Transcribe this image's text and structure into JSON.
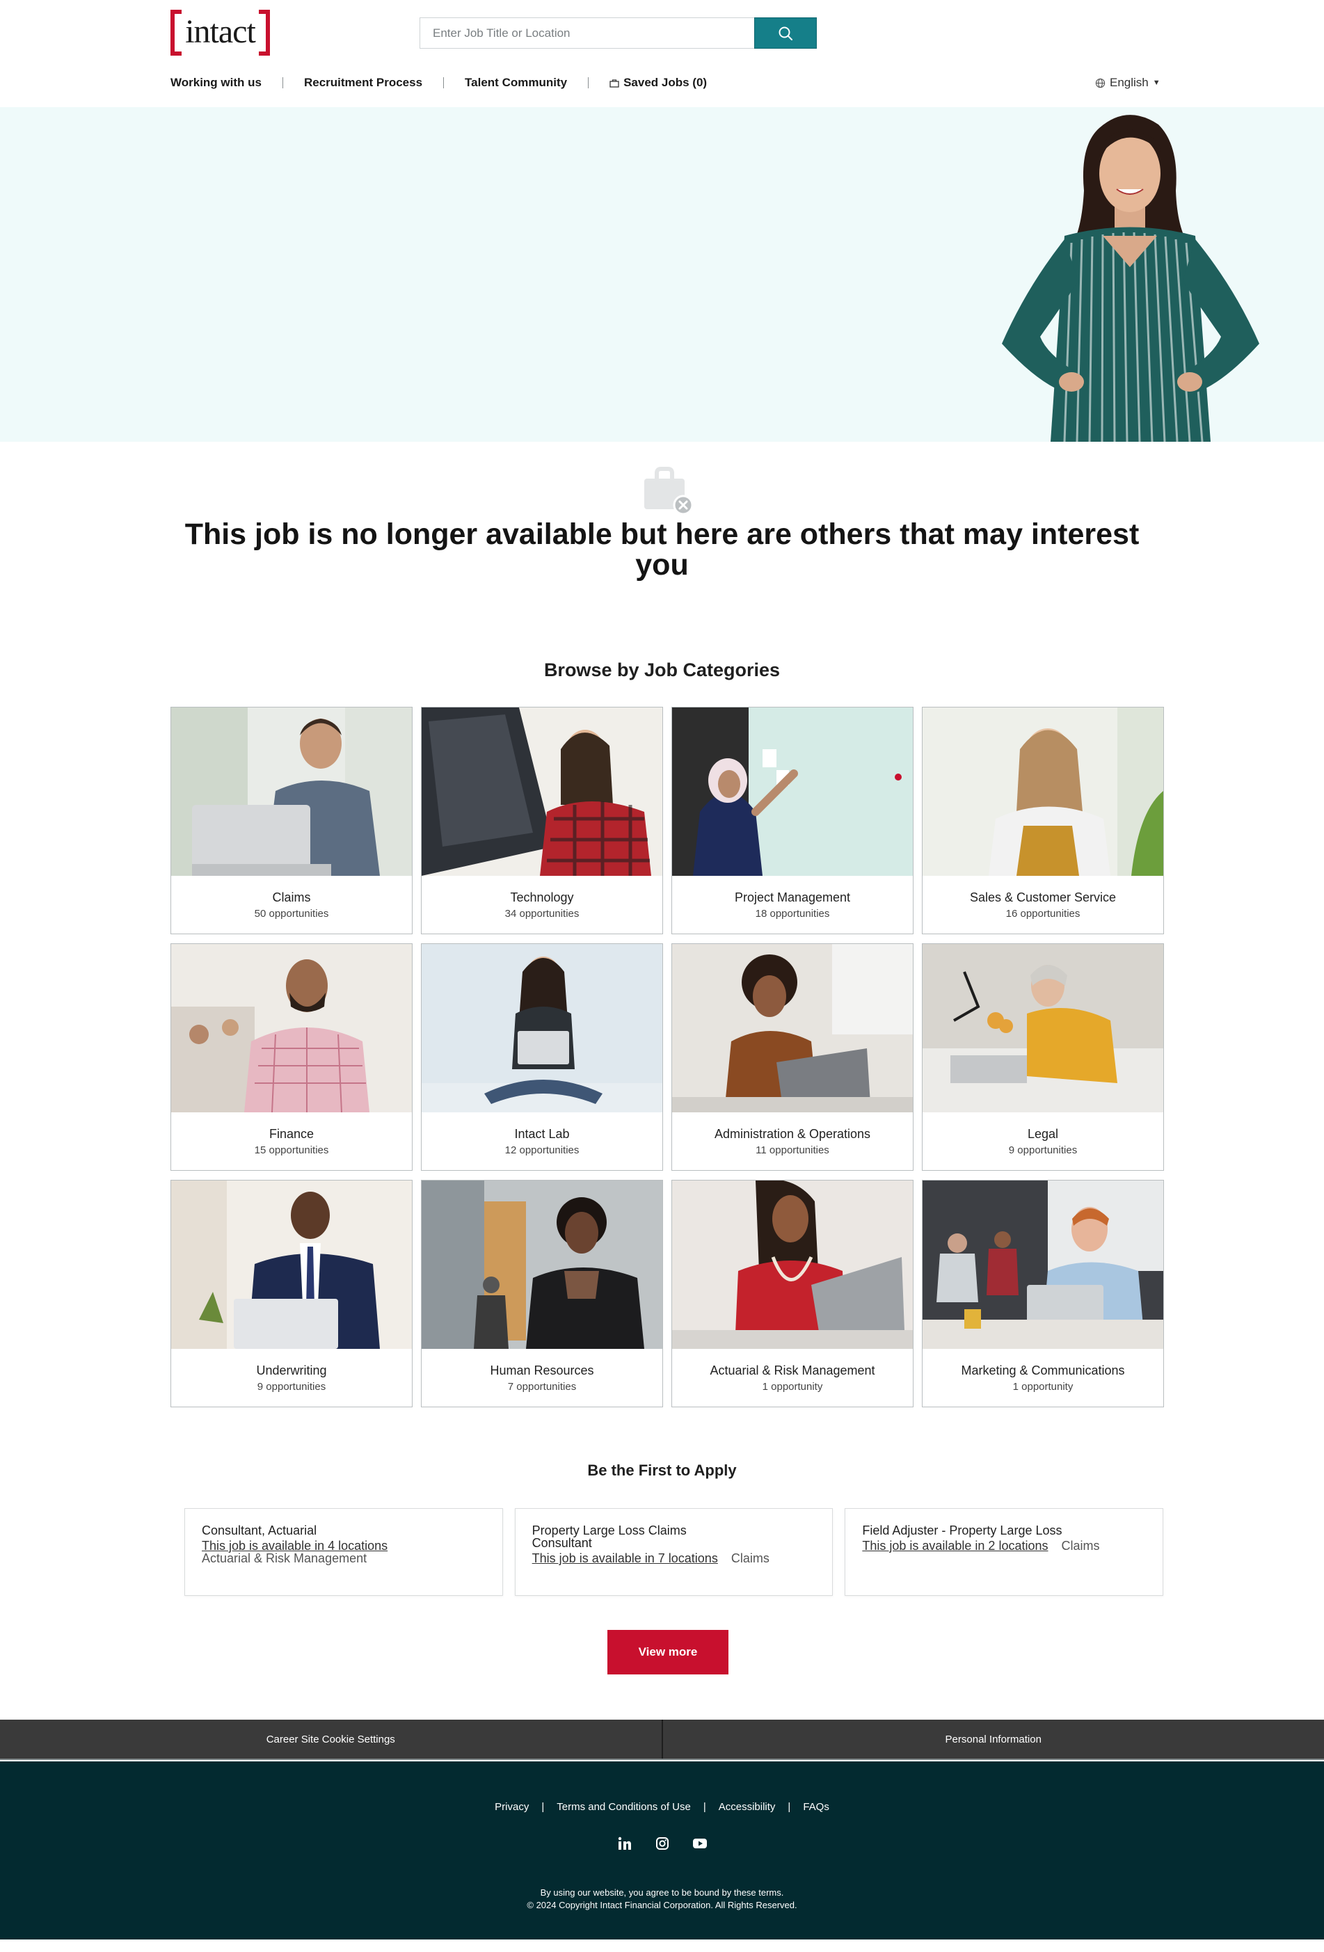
{
  "header": {
    "logo_text": "intact",
    "search": {
      "placeholder": "Enter Job Title or Location"
    },
    "nav": [
      {
        "label": "Working with us"
      },
      {
        "label": "Recruitment Process"
      },
      {
        "label": "Talent Community"
      },
      {
        "label": "Saved Jobs (0)"
      }
    ],
    "language": "English"
  },
  "notice": {
    "title": "This job is no longer available but here are others that may interest you"
  },
  "categories": {
    "title": "Browse by Job Categories",
    "items": [
      {
        "name": "Claims",
        "count": "50 opportunities"
      },
      {
        "name": "Technology",
        "count": "34 opportunities"
      },
      {
        "name": "Project Management",
        "count": "18 opportunities"
      },
      {
        "name": "Sales & Customer Service",
        "count": "16 opportunities"
      },
      {
        "name": "Finance",
        "count": "15 opportunities"
      },
      {
        "name": "Intact Lab",
        "count": "12 opportunities"
      },
      {
        "name": "Administration & Operations",
        "count": "11 opportunities"
      },
      {
        "name": "Legal",
        "count": "9 opportunities"
      },
      {
        "name": "Underwriting",
        "count": "9 opportunities"
      },
      {
        "name": "Human Resources",
        "count": "7 opportunities"
      },
      {
        "name": "Actuarial & Risk Management",
        "count": "1 opportunity"
      },
      {
        "name": "Marketing & Communications",
        "count": "1 opportunity"
      }
    ]
  },
  "jobs": {
    "title": "Be the First to Apply",
    "items": [
      {
        "title": "Consultant, Actuarial",
        "locations": "This job is available in 4 locations",
        "category": "Actuarial & Risk Management"
      },
      {
        "title": "Property Large Loss Claims Consultant",
        "locations": "This job is available in 7 locations",
        "category": "Claims"
      },
      {
        "title": "Field Adjuster - Property Large Loss",
        "locations": "This job is available in 2 locations",
        "category": "Claims"
      }
    ],
    "view_more": "View more"
  },
  "footer": {
    "cookie_settings": "Career Site Cookie Settings",
    "personal_information": "Personal Information",
    "links": [
      {
        "label": "Privacy"
      },
      {
        "label": "Terms and Conditions of Use"
      },
      {
        "label": "Accessibility"
      },
      {
        "label": "FAQs"
      }
    ],
    "social": [
      "linkedin-icon",
      "instagram-icon",
      "youtube-icon"
    ],
    "terms_line": "By using our website, you agree to be bound by these terms.",
    "copyright": "© 2024 Copyright Intact Financial Corporation. All Rights Reserved."
  },
  "colors": {
    "brand_red": "#c8102e",
    "teal": "#157f89",
    "hero_bg": "#effafa",
    "footer_bg": "#032a30",
    "cookie_bar_bg": "#3a3a3a"
  }
}
